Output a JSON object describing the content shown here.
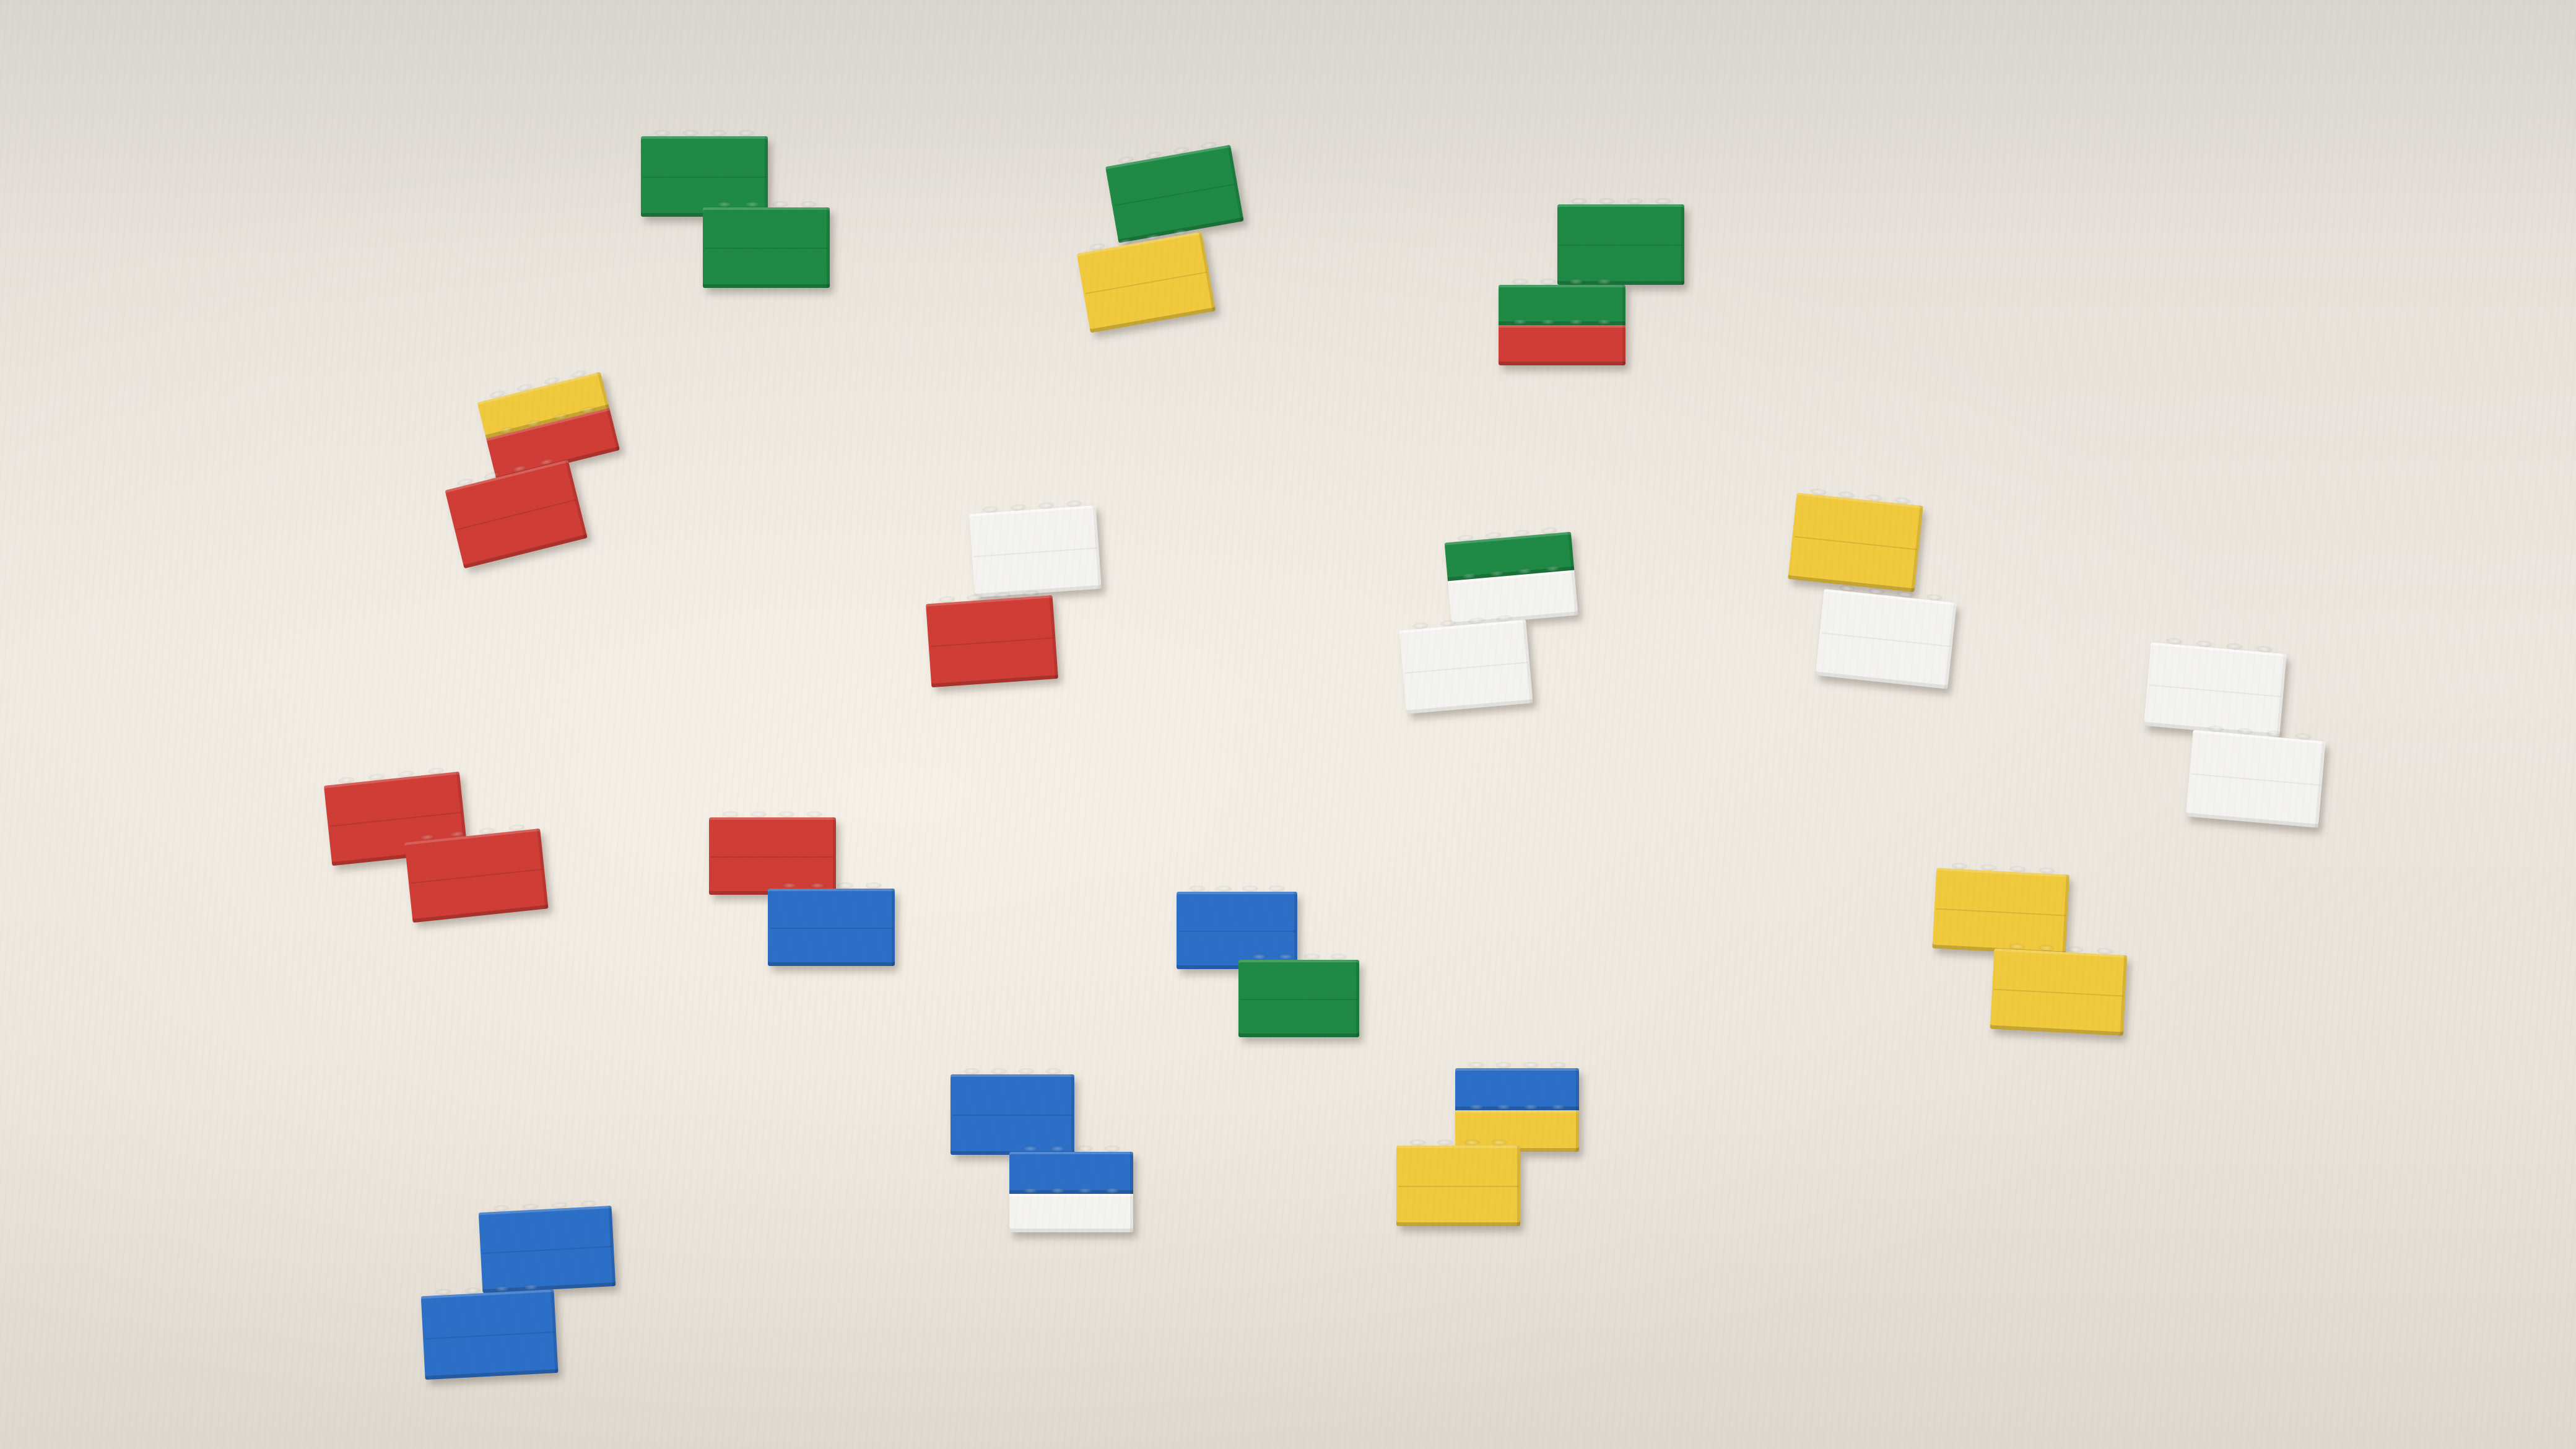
{
  "scene": {
    "subject": "lego-brick-s-z-shapes",
    "colors": {
      "green": "#1f8a45",
      "red": "#cf3d36",
      "yellow": "#f0c93d",
      "blue": "#2c6fc7",
      "white": "#f4f3f0",
      "table": "#e9e3da"
    },
    "piece_count": 16
  }
}
